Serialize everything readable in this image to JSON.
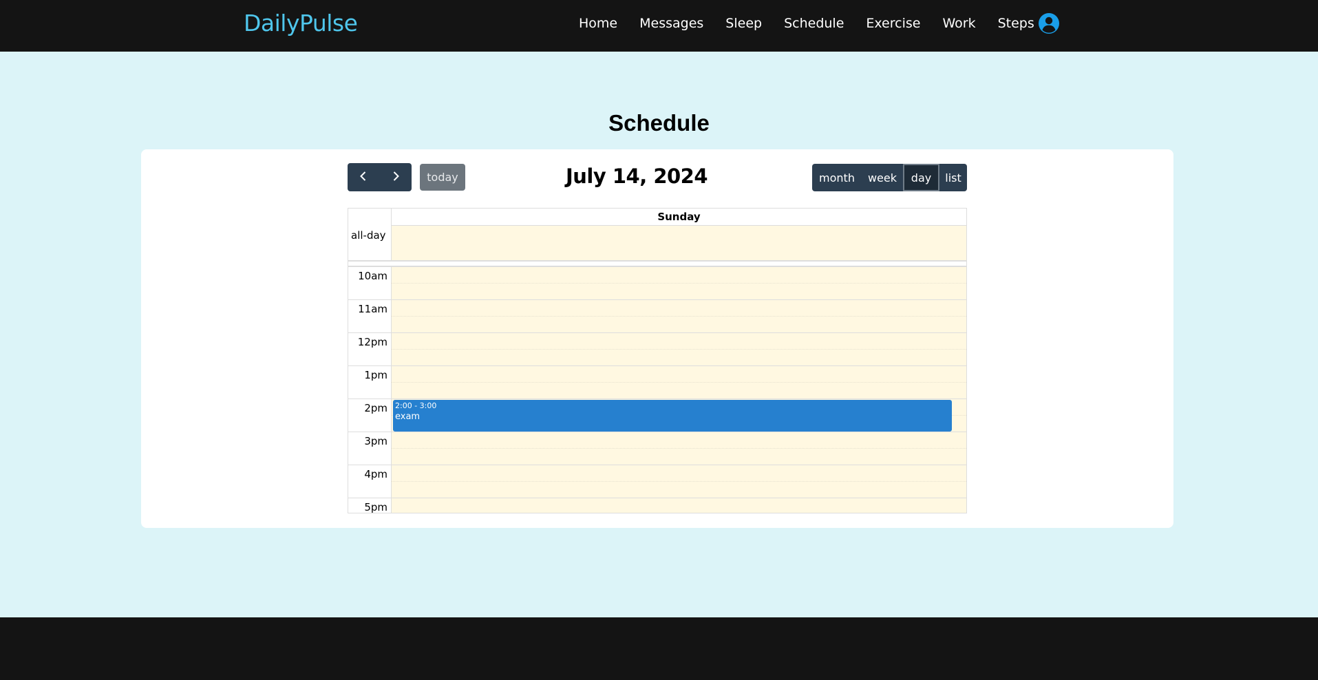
{
  "header": {
    "brand": "DailyPulse",
    "nav": [
      "Home",
      "Messages",
      "Sleep",
      "Schedule",
      "Exercise",
      "Work",
      "Steps"
    ],
    "user_icon": "user-circle-icon",
    "accent_color": "#4fc6ec"
  },
  "page": {
    "title": "Schedule"
  },
  "calendar": {
    "toolbar": {
      "prev_icon": "chevron-left-icon",
      "next_icon": "chevron-right-icon",
      "today_label": "today",
      "title": "July 14, 2024",
      "views": [
        "month",
        "week",
        "day",
        "list"
      ],
      "active_view": "day"
    },
    "day_header": "Sunday",
    "allday_label": "all-day",
    "hours": [
      "10am",
      "11am",
      "12pm",
      "1pm",
      "2pm",
      "3pm",
      "4pm",
      "5pm"
    ],
    "event": {
      "time": "2:00 - 3:00",
      "title": "exam",
      "color": "#2680cf"
    }
  },
  "colors": {
    "header_bg": "#141414",
    "page_bg": "#dcf4f8",
    "button_bg": "#2c3e50",
    "slot_bg": "#fff8e1"
  }
}
